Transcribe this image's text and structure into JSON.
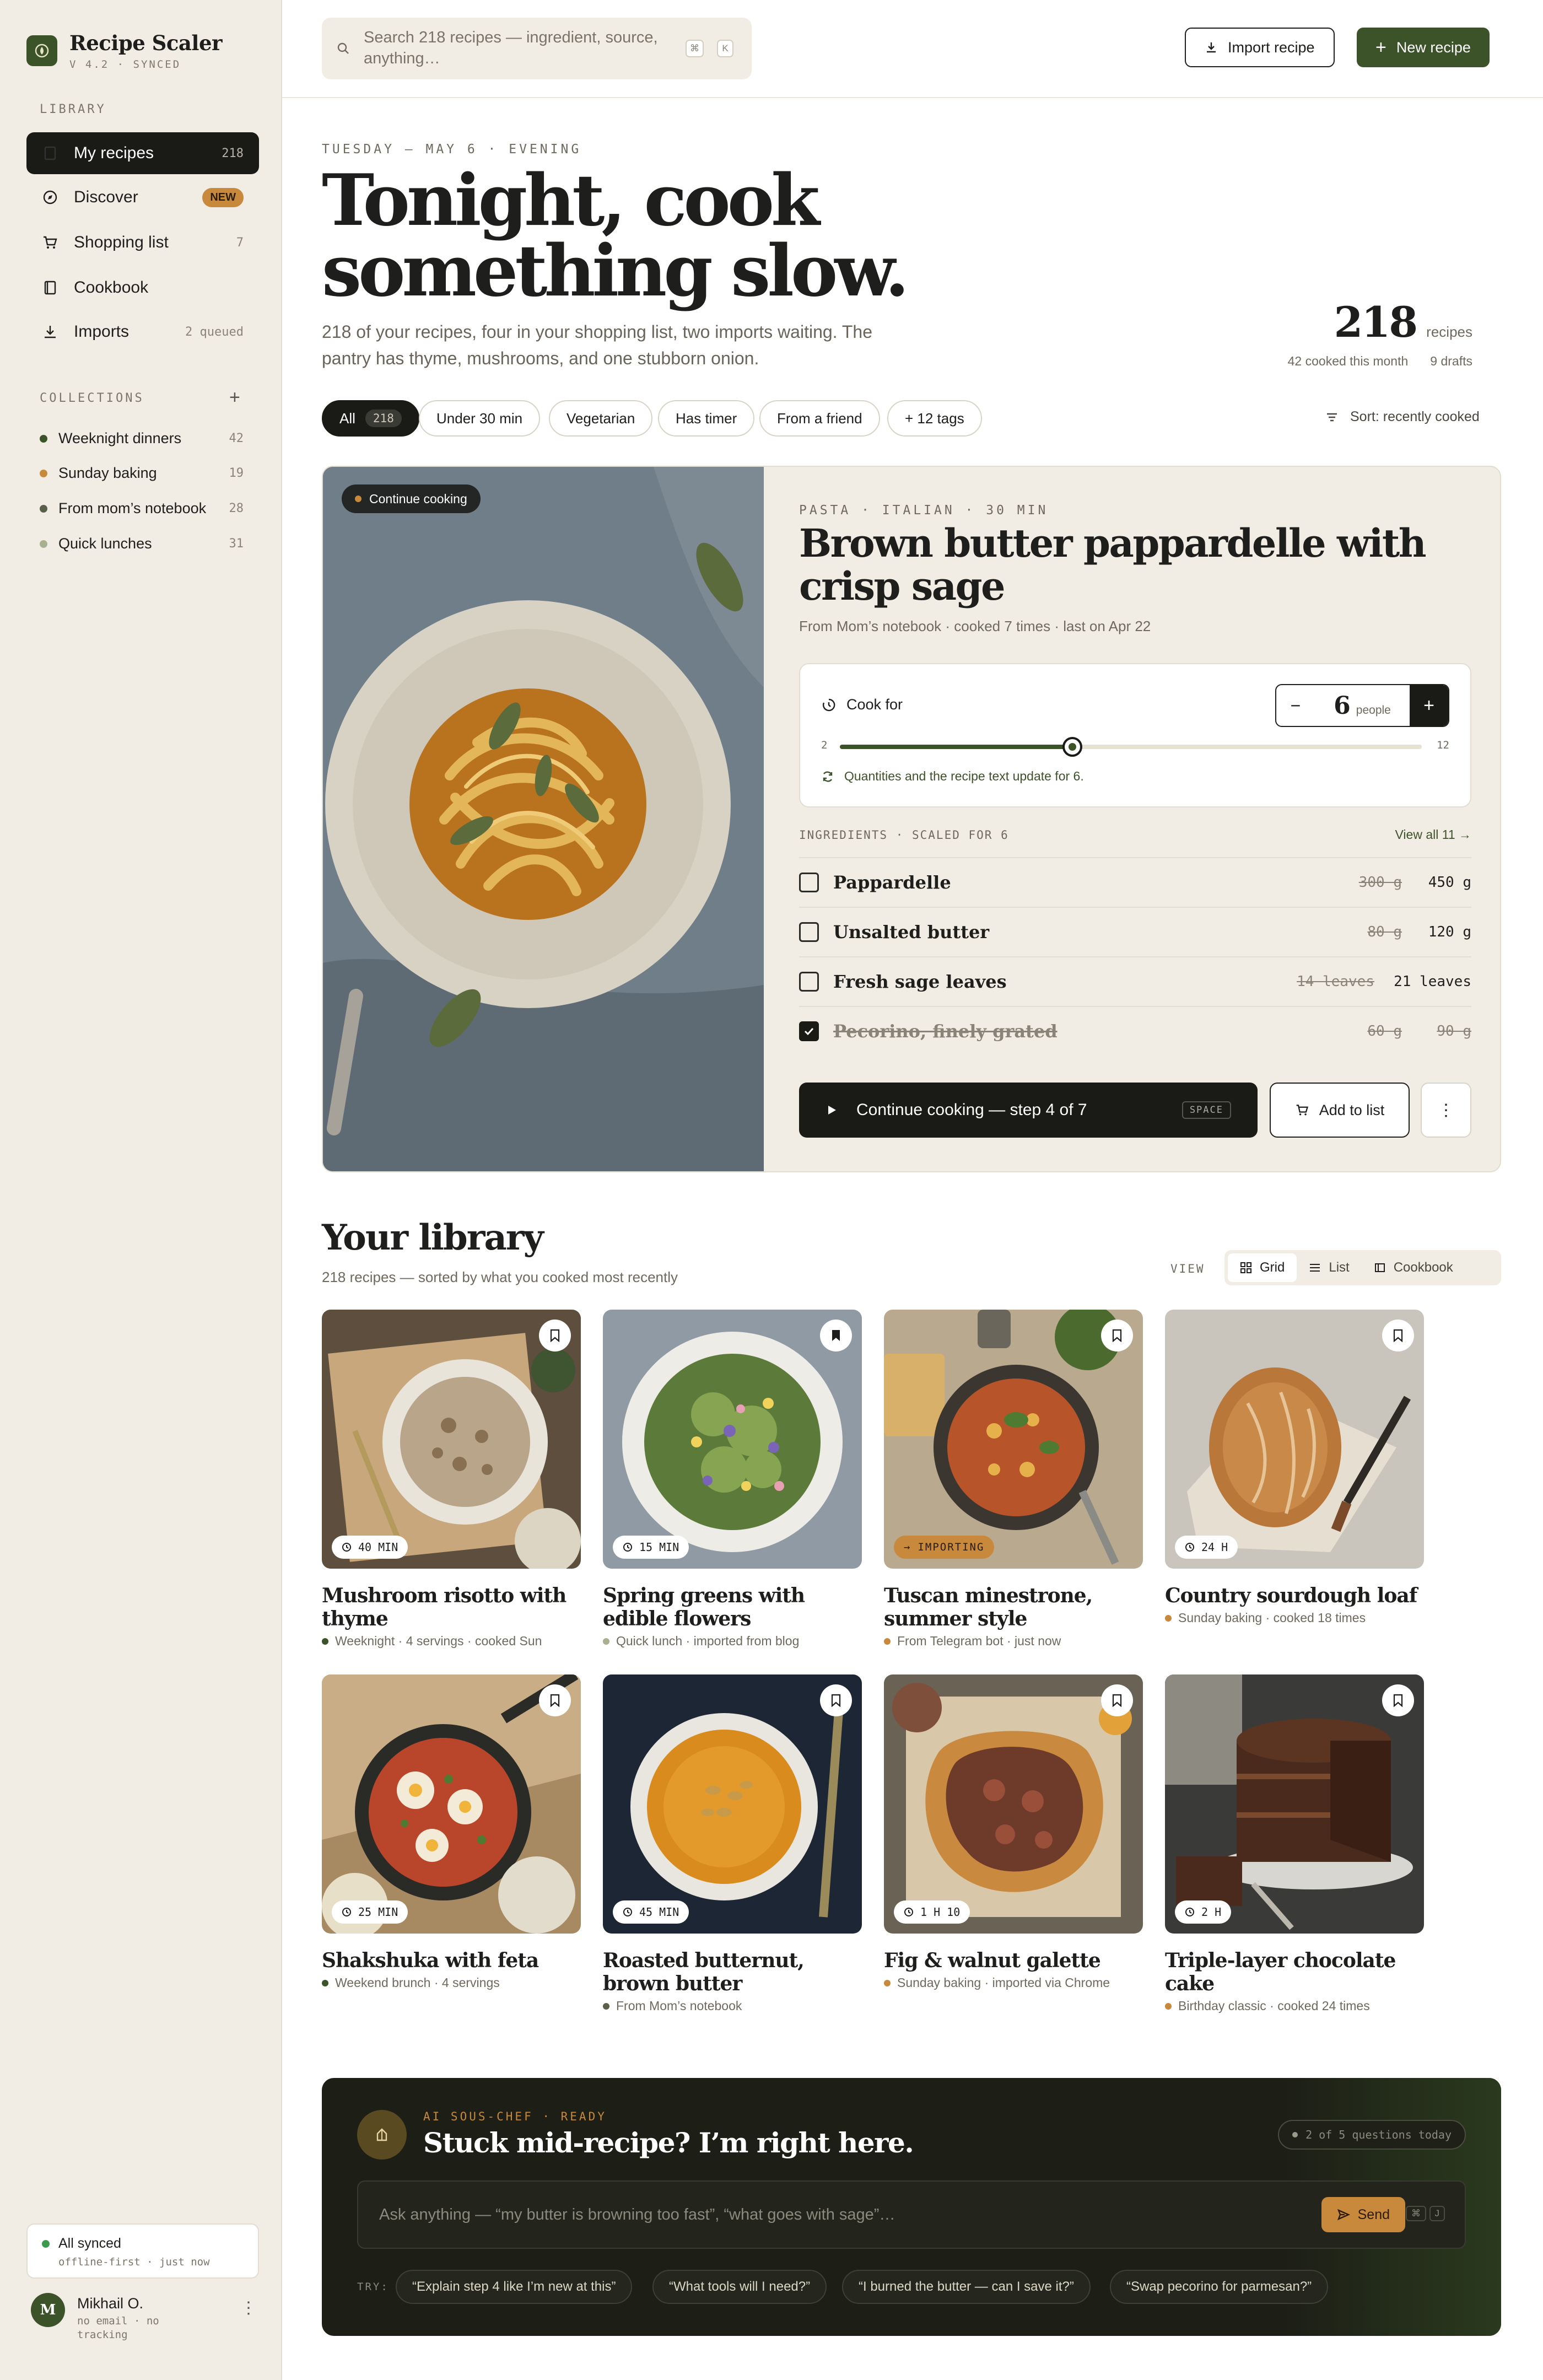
{
  "app": {
    "name": "Recipe Scaler",
    "version": "V 4.2 · SYNCED"
  },
  "sidebar": {
    "library_label": "LIBRARY",
    "items": [
      {
        "label": "My recipes",
        "count": "218"
      },
      {
        "label": "Discover",
        "badge": "NEW"
      },
      {
        "label": "Shopping list",
        "count": "7"
      },
      {
        "label": "Cookbook",
        "count": ""
      },
      {
        "label": "Imports",
        "count": "2 queued"
      }
    ],
    "collections_label": "COLLECTIONS",
    "collections": [
      {
        "label": "Weeknight dinners",
        "count": "42",
        "color": "#3c5229"
      },
      {
        "label": "Sunday baking",
        "count": "19",
        "color": "#c8893d"
      },
      {
        "label": "From mom’s notebook",
        "count": "28",
        "color": "#5a5f4a"
      },
      {
        "label": "Quick lunches",
        "count": "31",
        "color": "#a9b08f"
      }
    ],
    "sync": {
      "title": "All synced",
      "sub": "offline-first · just now"
    },
    "user": {
      "initial": "M",
      "name": "Mikhail O.",
      "sub": "no email · no tracking"
    }
  },
  "topbar": {
    "search_placeholder": "Search 218 recipes — ingredient, source, anything…",
    "kbd1": "⌘",
    "kbd2": "K",
    "import_label": "Import recipe",
    "new_label": "New recipe"
  },
  "hero": {
    "eyebrow": "TUESDAY — MAY 6 · EVENING",
    "title": "Tonight, cook something slow.",
    "lede": "218 of your recipes, four in your shopping list, two imports waiting. The pantry has thyme, mushrooms, and one stubborn onion.",
    "stat_value": "218",
    "stat_unit": "recipes",
    "stat_sub1": "42 cooked this month",
    "stat_sub2": "9 drafts"
  },
  "filters": {
    "chips": [
      "All",
      "Under 30 min",
      "Vegetarian",
      "Has timer",
      "From a friend",
      "+ 12 tags"
    ],
    "all_count": "218",
    "sort_label": "Sort: recently cooked"
  },
  "feature": {
    "pill": "Continue cooking",
    "eyebrow": "PASTA · ITALIAN · 30 MIN",
    "title": "Brown butter pappardelle with crisp sage",
    "meta": "From Mom’s notebook · cooked 7 times · last on Apr 22",
    "cook_for_label": "Cook for",
    "servings": "6",
    "servings_unit": "people",
    "slider_min": "2",
    "slider_max": "12",
    "slider_value": 6,
    "minus": "−",
    "plus": "+",
    "update_note": "Quantities and the recipe text update for 6.",
    "ingredients_label": "INGREDIENTS · SCALED FOR 6",
    "view_all": "View all 11 →",
    "ingredients": [
      {
        "name": "Pappardelle",
        "old": "300 g",
        "new": "450 g",
        "checked": false
      },
      {
        "name": "Unsalted butter",
        "old": "80 g",
        "new": "120 g",
        "checked": false
      },
      {
        "name": "Fresh sage leaves",
        "old": "14 leaves",
        "new": "21 leaves",
        "checked": false
      },
      {
        "name": "Pecorino, finely grated",
        "old": "60 g",
        "new": "90 g",
        "checked": true
      }
    ],
    "cta_label": "Continue cooking — step 4 of 7",
    "cta_kbd": "SPACE",
    "add_label": "Add to list"
  },
  "library": {
    "title": "Your library",
    "sub": "218 recipes — sorted by what you cooked most recently",
    "view_label": "VIEW",
    "views": [
      "Grid",
      "List",
      "Cookbook"
    ],
    "cards": [
      {
        "title": "Mushroom risotto with thyme",
        "meta": "Weeknight · 4 servings · cooked Sun",
        "time": "40 MIN",
        "dot": "#3c5229",
        "bookmarked": false
      },
      {
        "title": "Spring greens with edible flowers",
        "meta": "Quick lunch · imported from blog",
        "time": "15 MIN",
        "dot": "#a9b08f",
        "bookmarked": true
      },
      {
        "title": "Tuscan minestrone, summer style",
        "meta": "From Telegram bot · just now",
        "time": "IMPORTING",
        "dot": "#c8893d",
        "bookmarked": false
      },
      {
        "title": "Country sourdough loaf",
        "meta": "Sunday baking · cooked 18 times",
        "time": "24 H",
        "dot": "#c8893d",
        "bookmarked": false
      },
      {
        "title": "Shakshuka with feta",
        "meta": "Weekend brunch · 4 servings",
        "time": "25 MIN",
        "dot": "#3c5229",
        "bookmarked": false
      },
      {
        "title": "Roasted butternut, brown butter",
        "meta": "From Mom’s notebook",
        "time": "45 MIN",
        "dot": "#5a5f4a",
        "bookmarked": false
      },
      {
        "title": "Fig & walnut galette",
        "meta": "Sunday baking · imported via Chrome",
        "time": "1 H 10",
        "dot": "#c8893d",
        "bookmarked": false
      },
      {
        "title": "Triple-layer chocolate cake",
        "meta": "Birthday classic · cooked 24 times",
        "time": "2 H",
        "dot": "#c8893d",
        "bookmarked": false
      }
    ]
  },
  "ai": {
    "eyebrow": "AI SOUS-CHEF · READY",
    "title": "Stuck mid-recipe? I’m right here.",
    "quota": "2 of 5 questions today",
    "placeholder": "Ask anything — “my butter is browning too fast”, “what goes with sage”…",
    "send": "Send",
    "kbd1": "⌘",
    "kbd2": "J",
    "try_label": "TRY:",
    "suggestions": [
      "“Explain step 4 like I’m new at this”",
      "“What tools will I need?”",
      "“I burned the butter — can I save it?”",
      "“Swap pecorino for parmesan?”"
    ]
  }
}
